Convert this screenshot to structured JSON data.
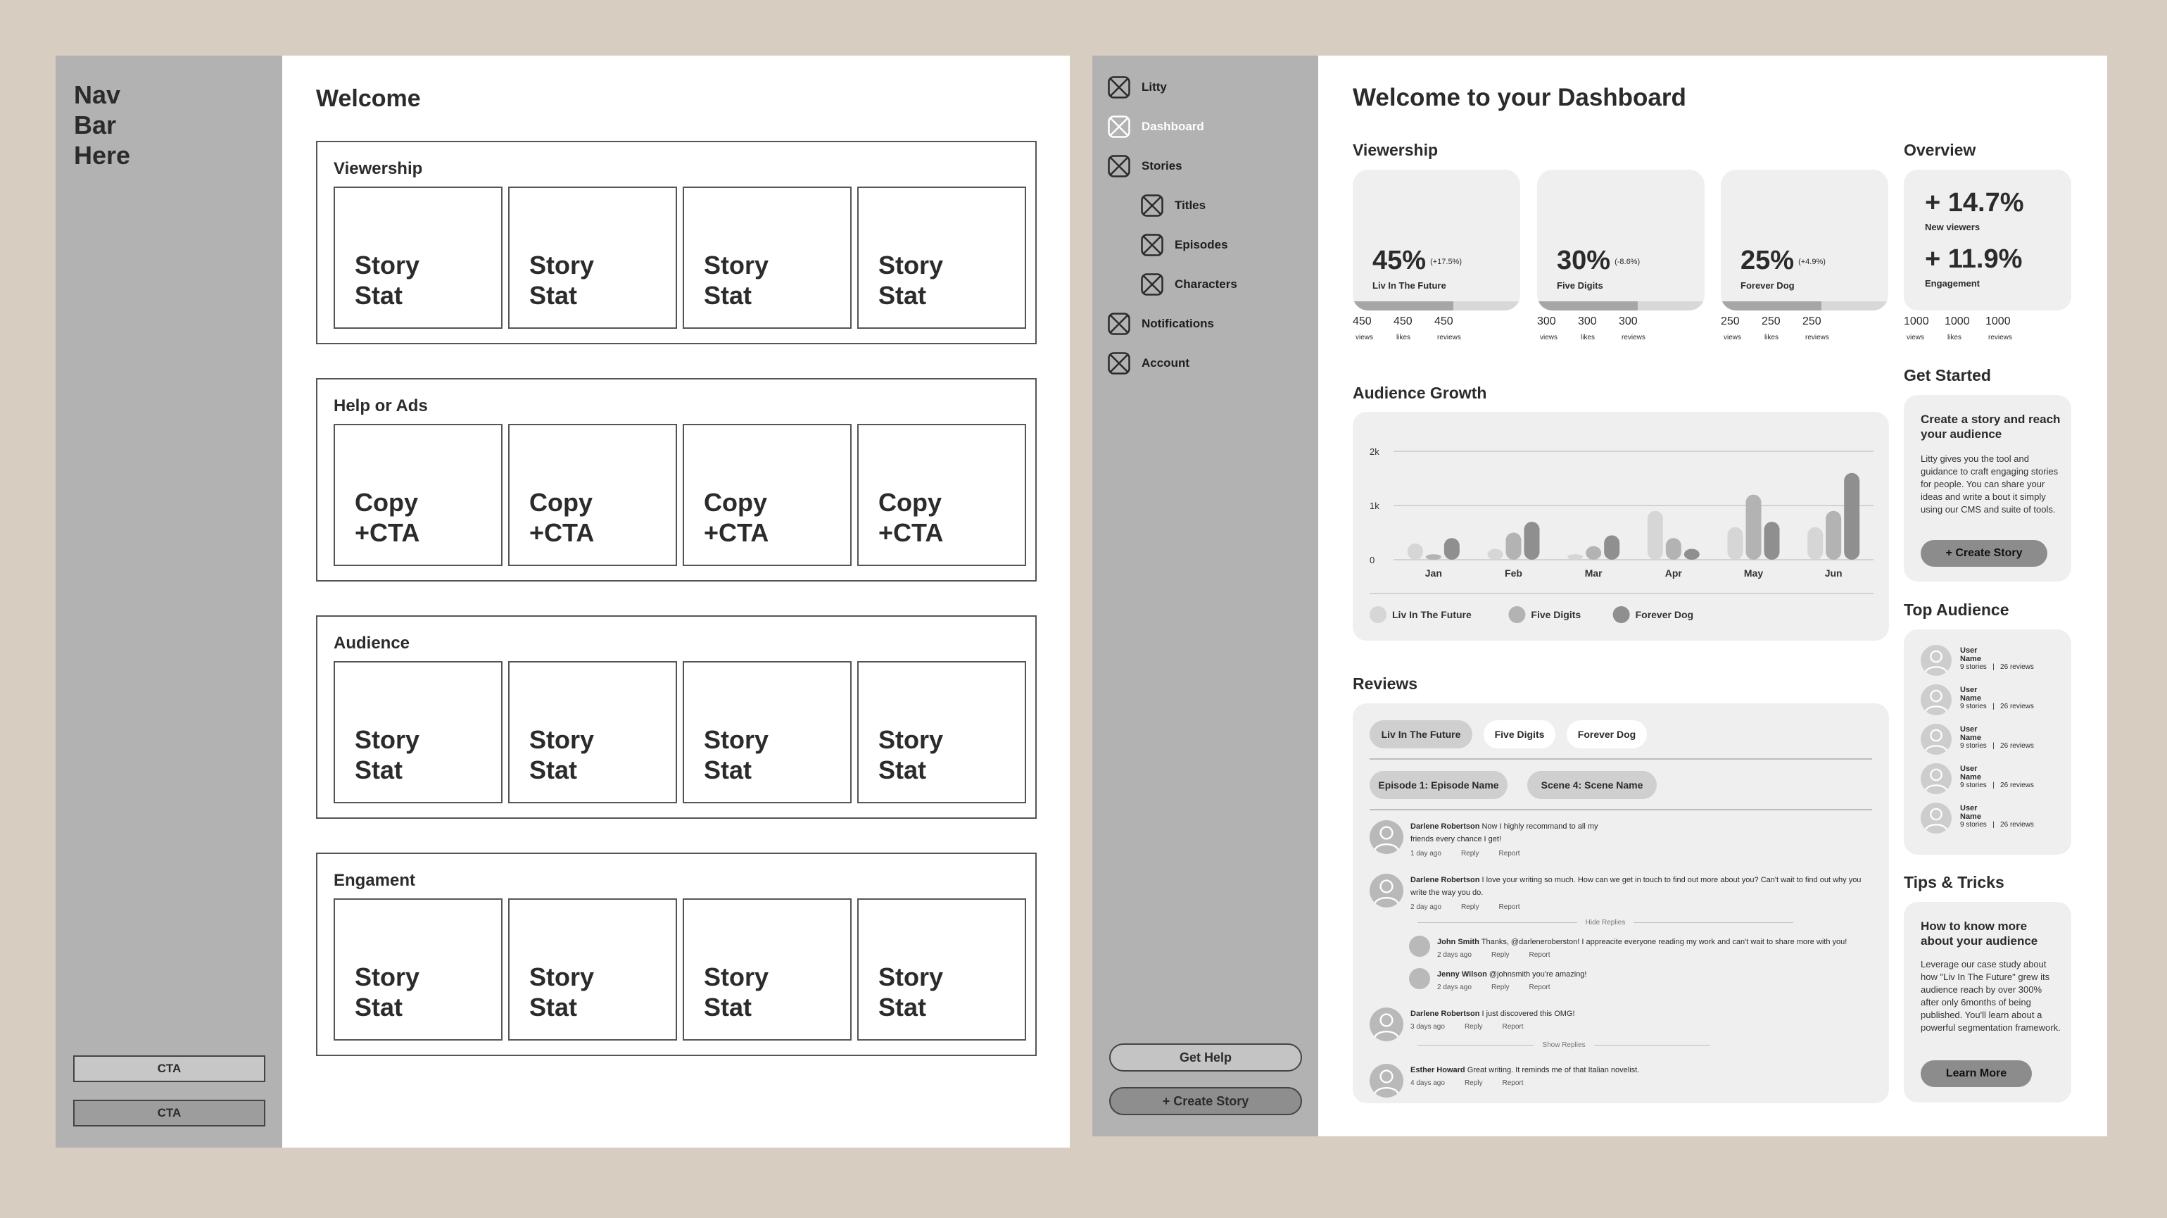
{
  "wireframe1": {
    "nav_title": "Nav\nBar\nHere",
    "cta1": "CTA",
    "cta2": "CTA",
    "welcome": "Welcome",
    "sections": [
      {
        "title": "Viewership",
        "cards": [
          "Story\nStat",
          "Story\nStat",
          "Story\nStat",
          "Story\nStat"
        ]
      },
      {
        "title": "Help or Ads",
        "cards": [
          "Copy\n+CTA",
          "Copy\n+CTA",
          "Copy\n+CTA",
          "Copy\n+CTA"
        ]
      },
      {
        "title": "Audience",
        "cards": [
          "Story\nStat",
          "Story\nStat",
          "Story\nStat",
          "Story\nStat"
        ]
      },
      {
        "title": "Engament",
        "cards": [
          "Story\nStat",
          "Story\nStat",
          "Story\nStat",
          "Story\nStat"
        ]
      }
    ]
  },
  "dashboard": {
    "sidebar": {
      "items": [
        {
          "label": "Litty",
          "active": false
        },
        {
          "label": "Dashboard",
          "active": true
        },
        {
          "label": "Stories",
          "active": false
        },
        {
          "label": "Titles",
          "active": false
        },
        {
          "label": "Episodes",
          "active": false
        },
        {
          "label": "Characters",
          "active": false
        },
        {
          "label": "Notifications",
          "active": false
        },
        {
          "label": "Account",
          "active": false
        }
      ],
      "help_button": "Get Help",
      "create_button": "+ Create Story"
    },
    "title": "Welcome to your Dashboard",
    "viewership": {
      "heading": "Viewership",
      "cards": [
        {
          "percent": "45%",
          "change": "(+17.5%)",
          "name": "Liv In The Future",
          "progress": 0.6,
          "stats": [
            {
              "value": "450",
              "label": "views"
            },
            {
              "value": "450",
              "label": "likes"
            },
            {
              "value": "450",
              "label": "reviews"
            }
          ]
        },
        {
          "percent": "30%",
          "change": "(-8.6%)",
          "name": "Five Digits",
          "progress": 0.6,
          "stats": [
            {
              "value": "300",
              "label": "views"
            },
            {
              "value": "300",
              "label": "likes"
            },
            {
              "value": "300",
              "label": "reviews"
            }
          ]
        },
        {
          "percent": "25%",
          "change": "(+4.9%)",
          "name": "Forever Dog",
          "progress": 0.6,
          "stats": [
            {
              "value": "250",
              "label": "views"
            },
            {
              "value": "250",
              "label": "likes"
            },
            {
              "value": "250",
              "label": "reviews"
            }
          ]
        }
      ]
    },
    "overview": {
      "heading": "Overview",
      "new_viewers_value": "+ 14.7%",
      "new_viewers_label": "New viewers",
      "engagement_value": "+ 11.9%",
      "engagement_label": "Engagement",
      "stats": [
        {
          "value": "1000",
          "label": "views"
        },
        {
          "value": "1000",
          "label": "likes"
        },
        {
          "value": "1000",
          "label": "reviews"
        }
      ]
    },
    "audience_growth": {
      "heading": "Audience Growth"
    },
    "chart_data": {
      "type": "bar",
      "categories": [
        "Jan",
        "Feb",
        "Mar",
        "Apr",
        "May",
        "Jun"
      ],
      "yticks": [
        "0",
        "1k",
        "2k"
      ],
      "ylim": [
        0,
        2000
      ],
      "series": [
        {
          "name": "Liv In The Future",
          "color": "#d6d6d6",
          "values": [
            300,
            200,
            100,
            900,
            600,
            600
          ]
        },
        {
          "name": "Five Digits",
          "color": "#b3b3b3",
          "values": [
            100,
            500,
            250,
            400,
            1200,
            900
          ]
        },
        {
          "name": "Forever Dog",
          "color": "#8f8f8f",
          "values": [
            400,
            700,
            450,
            200,
            700,
            1600
          ]
        }
      ],
      "legend": "bottom-left",
      "grid": true
    },
    "reviews": {
      "heading": "Reviews",
      "story_tabs": [
        {
          "label": "Liv In The Future",
          "active": true
        },
        {
          "label": "Five Digits",
          "active": false
        },
        {
          "label": "Forever Dog",
          "active": false
        }
      ],
      "episode_filter": "Episode 1: Episode  Name",
      "scene_filter": "Scene 4: Scene  Name",
      "reply_label": "Reply",
      "report_label": "Report",
      "hide_replies": "Hide Replies",
      "show_replies": "Show Replies",
      "comments": [
        {
          "author": "Darlene Robertson",
          "text": "Now I highly recommand to all my friends every chance I get!",
          "time": "1 day ago"
        },
        {
          "author": "Darlene Robertson",
          "text": "I love your writing so much. How can we get in touch to find out more about you? Can't wait to find out why you write the way you do.",
          "time": "2 day ago"
        },
        {
          "author": "John Smith",
          "text": "Thanks, @darleneroberston! I appreacite everyone reading my work and can't wait to share more with you!",
          "time": "2 days ago"
        },
        {
          "author": "Jenny Wilson",
          "text": "@johnsmith you're amazing!",
          "time": "2 days ago"
        },
        {
          "author": "Darlene Robertson",
          "text": "I just discovered this OMG!",
          "time": "3 days ago"
        },
        {
          "author": "Esther Howard",
          "text": "Great writing. It reminds me of that Italian novelist.",
          "time": "4 days ago"
        }
      ]
    },
    "get_started": {
      "heading": "Get Started",
      "title": "Create a story and reach your audience",
      "body": "Litty gives you the tool and guidance to craft engaging stories for people. You can share your ideas and write a bout it simply using our CMS and suite of tools.",
      "button": "+ Create Story"
    },
    "top_audience": {
      "heading": "Top Audience",
      "users": [
        {
          "name": "User Name",
          "stats": "9 stories   |   26 reviews"
        },
        {
          "name": "User Name",
          "stats": "9 stories   |   26 reviews"
        },
        {
          "name": "User Name",
          "stats": "9 stories   |   26 reviews"
        },
        {
          "name": "User Name",
          "stats": "9 stories   |   26 reviews"
        },
        {
          "name": "User Name",
          "stats": "9 stories   |   26 reviews"
        }
      ]
    },
    "tips": {
      "heading": "Tips & Tricks",
      "title": "How to know more about your audience",
      "body": "Leverage our case study about how \"Liv In The Future\" grew its audience reach by over 300% after only 6months of being published. You'll learn about a powerful segmentation framework.",
      "button": "Learn More"
    }
  }
}
